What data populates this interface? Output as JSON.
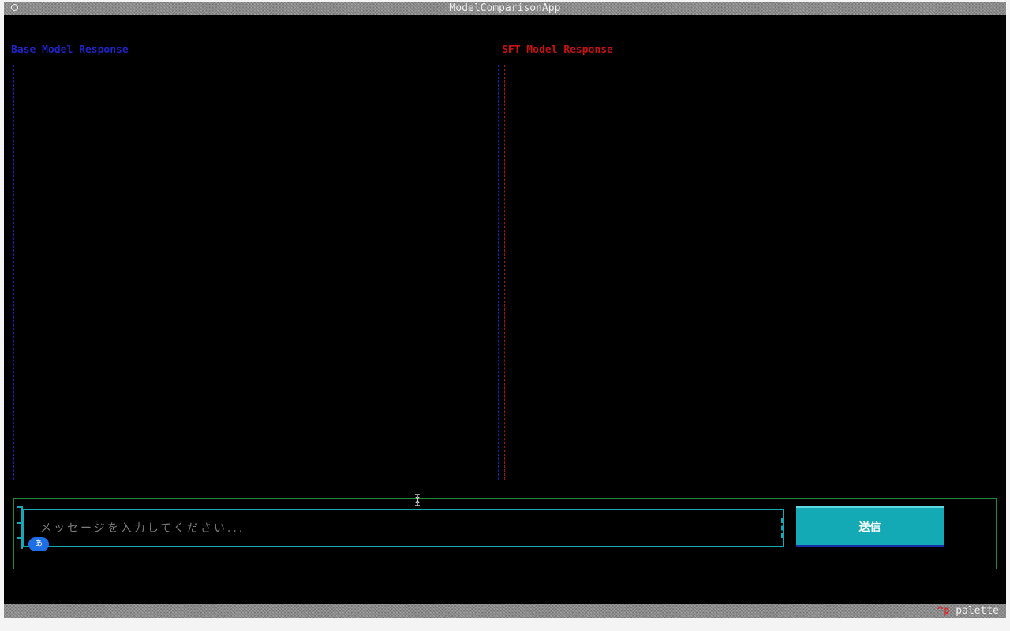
{
  "app": {
    "title": "ModelComparisonApp"
  },
  "panels": {
    "base": {
      "label": "Base Model Response",
      "color": "#1f24c8"
    },
    "sft": {
      "label": "SFT Model Response",
      "color": "#c81010"
    }
  },
  "input": {
    "placeholder": "メッセージを入力してください...",
    "value": "",
    "ime_indicator": "あ"
  },
  "send_button": {
    "label": "送信"
  },
  "footer": {
    "key": "^p",
    "label": "palette"
  },
  "colors": {
    "input_border": "#17a8b8",
    "container_border": "#1e8a3a",
    "button_bg": "#13a9b5"
  }
}
